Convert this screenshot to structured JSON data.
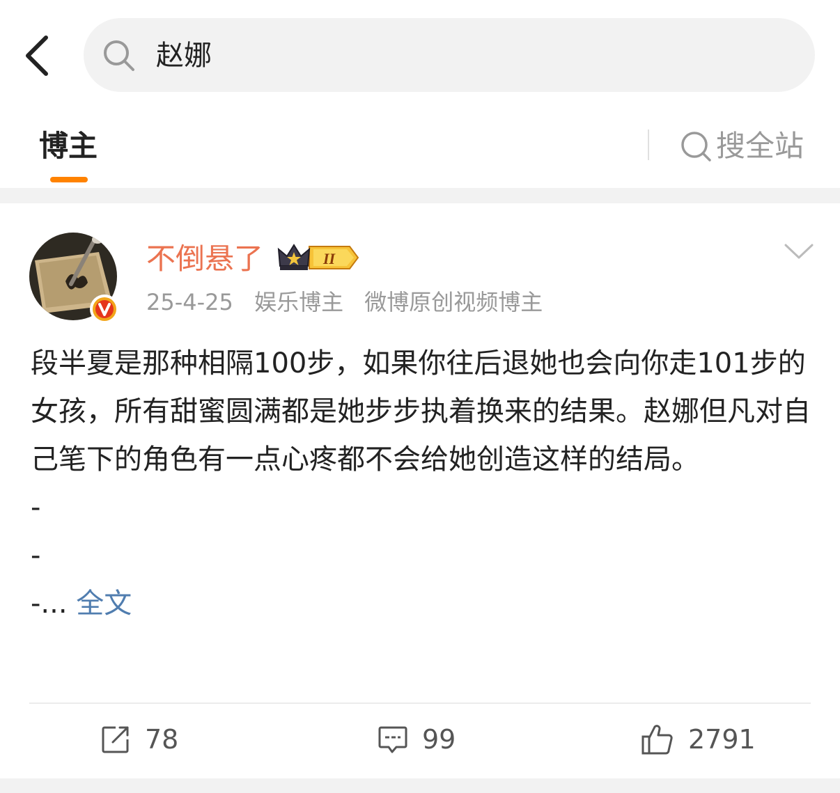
{
  "search": {
    "query": "赵娜"
  },
  "tabs": {
    "active_label": "博主",
    "search_all_label": "搜全站"
  },
  "post": {
    "username": "不倒悬了",
    "badge_text": "II",
    "date": "25-4-25",
    "tags": [
      "娱乐博主",
      "微博原创视频博主"
    ],
    "paragraph": "段半夏是那种相隔100步，如果你往后退她也会向你走101步的女孩，所有甜蜜圆满都是她步步执着换来的结果。赵娜但凡对自己笔下的角色有一点心疼都不会给她创造这样的结局。",
    "dash_lines": [
      "-",
      "-"
    ],
    "last_line_prefix": "-... ",
    "fulltext_label": "全文"
  },
  "actions": {
    "repost_count": "78",
    "comment_count": "99",
    "like_count": "2791"
  },
  "colors": {
    "accent_orange": "#ff8200",
    "username_color": "#eb7350",
    "link_blue": "#507daf",
    "muted_gray": "#999999",
    "background_gray": "#f2f2f2"
  },
  "icons": [
    "back-arrow-icon",
    "search-icon",
    "search-all-icon",
    "verified-v-icon",
    "crown-badge-icon",
    "chevron-down-icon",
    "repost-icon",
    "comment-icon",
    "like-icon"
  ]
}
